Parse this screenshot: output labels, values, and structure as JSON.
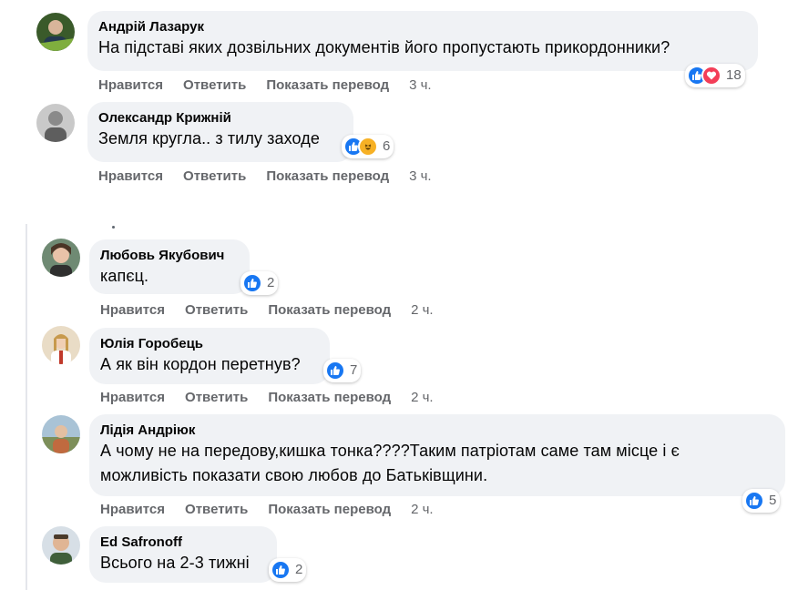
{
  "actions": {
    "like": "Нравится",
    "reply": "Ответить",
    "translate": "Показать перевод"
  },
  "comments": [
    {
      "author": "Андрій Лазарук",
      "text": "На підставі яких дозвільних документів його пропустають прикордонники?",
      "reaction_icons": [
        "like",
        "love"
      ],
      "reaction_count": "18",
      "time": "3 ч."
    },
    {
      "author": "Олександр Крижній",
      "text": "Земля кругла.. з тилу заходе",
      "reaction_icons": [
        "like",
        "haha"
      ],
      "reaction_count": "6",
      "time": "3 ч."
    },
    {
      "author": "Любовь Якубович",
      "text": "капєц.",
      "reaction_icons": [
        "like"
      ],
      "reaction_count": "2",
      "time": "2 ч."
    },
    {
      "author": "Юлія Горобець",
      "text": "А як він кордон перетнув?",
      "reaction_icons": [
        "like"
      ],
      "reaction_count": "7",
      "time": "2 ч."
    },
    {
      "author": "Лідія Андріюк",
      "text_line1": "А чому не на передову,кишка тонка????Таким патріотам саме там місце і є",
      "text_line2": "можливість показати свою любов до Батьківщини.",
      "reaction_icons": [
        "like"
      ],
      "reaction_count": "5",
      "time": "2 ч."
    },
    {
      "author": "Ed Safronoff",
      "text": "Всього на 2-3 тижні",
      "reaction_icons": [
        "like"
      ],
      "reaction_count": "2"
    }
  ],
  "colors": {
    "bubble": "#f0f2f5",
    "secondary_text": "#65676b",
    "like_blue": "#1877f2",
    "love_red": "#f33e58",
    "haha_yellow": "#f7b125"
  }
}
